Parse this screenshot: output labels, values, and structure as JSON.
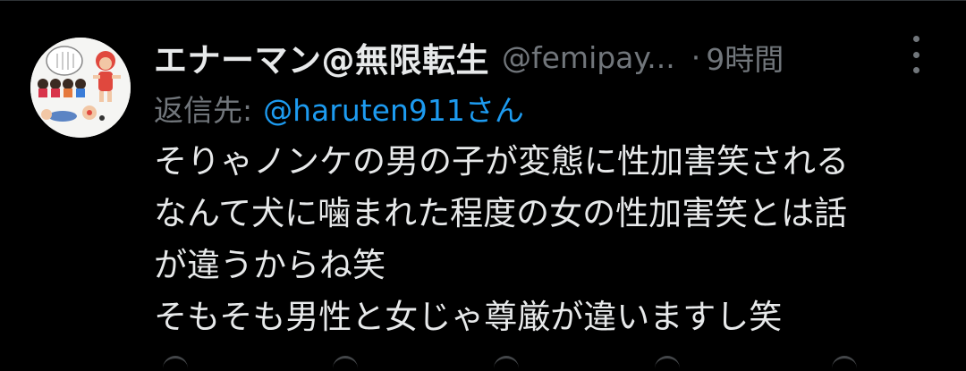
{
  "tweet": {
    "display_name": "エナーマン@無限転生",
    "handle": "@femipay...",
    "separator": "·",
    "time": "9時間",
    "reply_prefix": "返信先:",
    "reply_to": "@haruten911さん",
    "text_lines": [
      "そりゃノンケの男の子が変態に性加害笑される",
      "なんて犬に噛まれた程度の女の性加害笑とは話",
      "が違うからね笑",
      "そもそも男性と女じゃ尊厳が違いますし笑"
    ]
  },
  "colors": {
    "background": "#000000",
    "primary_text": "#e7e9ea",
    "secondary_text": "#71767b",
    "link": "#1d9bf0"
  },
  "icons": {
    "more": "more-horizontal-dots-icon"
  }
}
